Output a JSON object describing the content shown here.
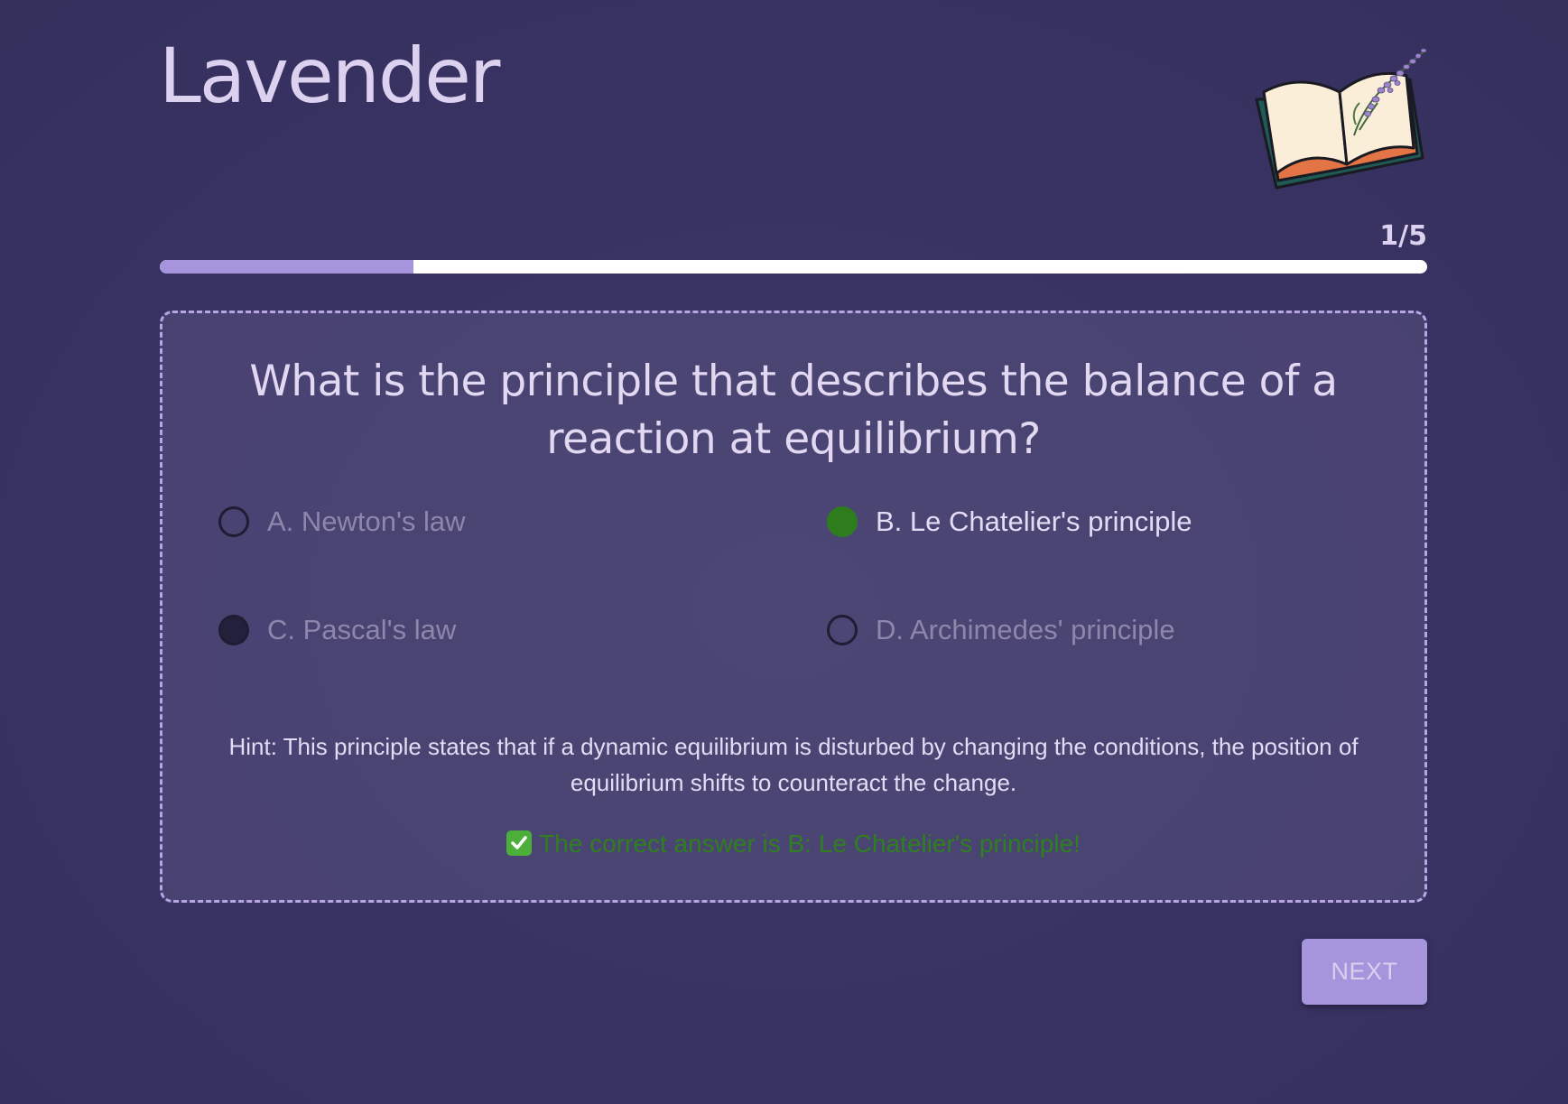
{
  "header": {
    "title": "Lavender",
    "logo_icon": "open-book-with-lavender-icon"
  },
  "progress": {
    "label": "1/5",
    "current": 1,
    "total": 5,
    "fill_fraction": 0.2,
    "fill_color": "#a695dd"
  },
  "question": {
    "text": "What is the principle that describes the balance of a reaction at equilibrium?"
  },
  "options": [
    {
      "label": "A. Newton's law",
      "state": "empty"
    },
    {
      "label": "B. Le Chatelier's principle",
      "state": "correct-selected"
    },
    {
      "label": "C. Pascal's law",
      "state": "filled-dark"
    },
    {
      "label": "D. Archimedes' principle",
      "state": "empty"
    }
  ],
  "hint": {
    "text": "Hint: This principle states that if a dynamic equilibrium is disturbed by changing the conditions, the position of equilibrium shifts to counteract the change."
  },
  "result": {
    "icon": "check-mark-icon",
    "text": "The correct answer is B: Le Chatelier's principle!",
    "color": "#2f7f1e"
  },
  "actions": {
    "next_label": "NEXT"
  },
  "colors": {
    "background": "#383262",
    "accent": "#a695dd",
    "title": "#ddd1f0",
    "correct_green": "#2e7d1c"
  }
}
